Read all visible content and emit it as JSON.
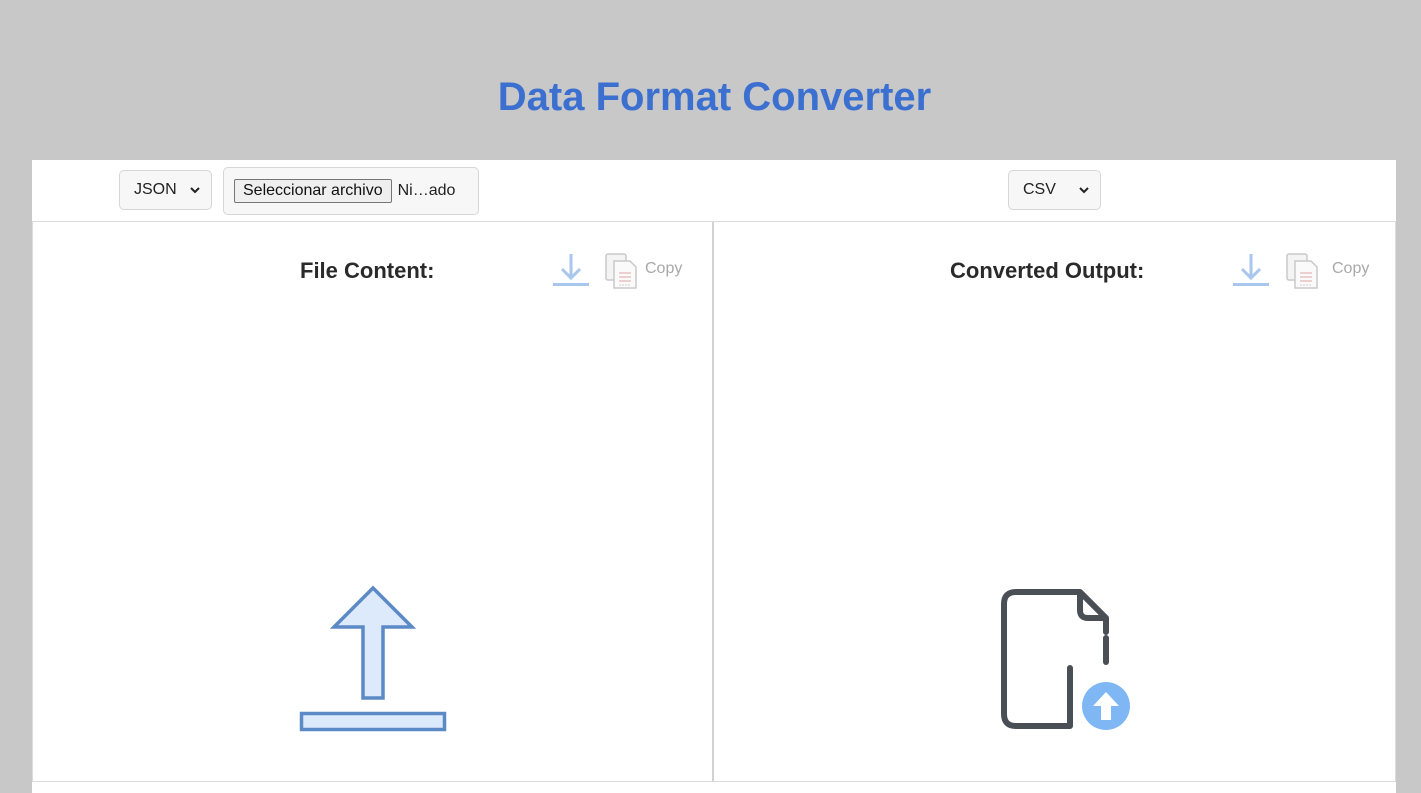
{
  "app": {
    "title": "Data Format Converter"
  },
  "toolbar": {
    "input_format": "JSON",
    "file_button_label": "Seleccionar archivo",
    "file_name": "Ni…ado",
    "output_format": "CSV"
  },
  "input_panel": {
    "title": "File Content:",
    "copy_label": "Copy"
  },
  "output_panel": {
    "title": "Converted Output:",
    "copy_label": "Copy"
  },
  "icons": {
    "download": "download-icon",
    "copy": "copy-icon",
    "upload_placeholder": "upload-arrow-icon",
    "file_upload_placeholder": "file-upload-icon",
    "dropdown": "chevron-down-icon"
  },
  "colors": {
    "page_background": "#c8c8c8",
    "title": "#3b6fd0",
    "icon_blue": "#5b8ac6",
    "icon_fill": "#ddeafb",
    "upload_badge": "#7fb7f5",
    "disabled_icon": "#a9c6ee"
  }
}
